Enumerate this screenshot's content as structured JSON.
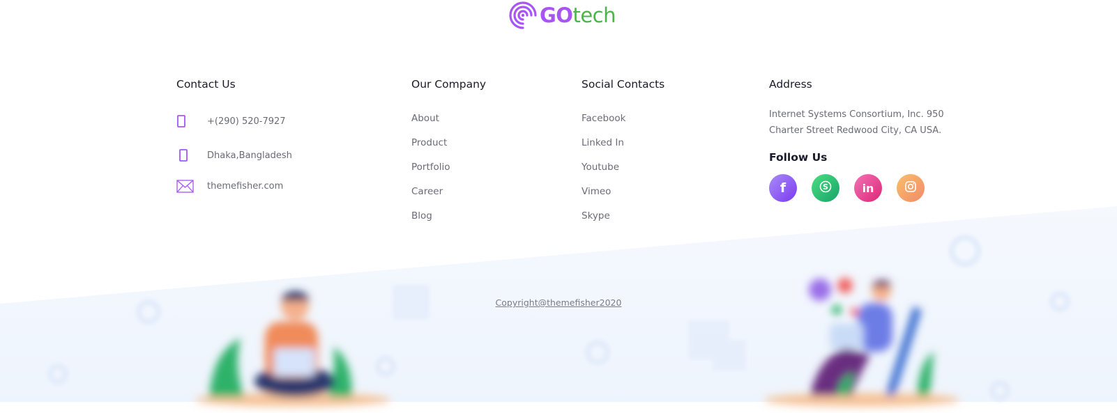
{
  "logo": {
    "part1": "GO",
    "part2": "tech",
    "brand_color": "#a855f7",
    "accent_color": "#4ab548"
  },
  "contact": {
    "title": "Contact Us",
    "items": [
      {
        "icon": "phone-icon",
        "text": "+(290) 520-7927"
      },
      {
        "icon": "location-icon",
        "text": "Dhaka,Bangladesh"
      },
      {
        "icon": "envelope-icon",
        "text": "themefisher.com"
      }
    ]
  },
  "company": {
    "title": "Our Company",
    "links": [
      "About",
      "Product",
      "Portfolio",
      "Career",
      "Blog"
    ]
  },
  "social": {
    "title": "Social Contacts",
    "links": [
      "Facebook",
      "Linked In",
      "Youtube",
      "Vimeo",
      "Skype"
    ]
  },
  "address": {
    "title": "Address",
    "text": "Internet Systems Consortium, Inc. 950 Charter Street Redwood City, CA USA.",
    "follow_title": "Follow Us",
    "icons": [
      {
        "name": "facebook-icon",
        "glyph": "f",
        "color": "#8b5cf6"
      },
      {
        "name": "skype-icon",
        "glyph": "S",
        "color": "#22c07a"
      },
      {
        "name": "linkedin-icon",
        "glyph": "in",
        "color": "#ec4899"
      },
      {
        "name": "instagram-icon",
        "glyph": "◎",
        "color": "#f4a261"
      }
    ]
  },
  "copyright": "Copyright@themefisher2020"
}
